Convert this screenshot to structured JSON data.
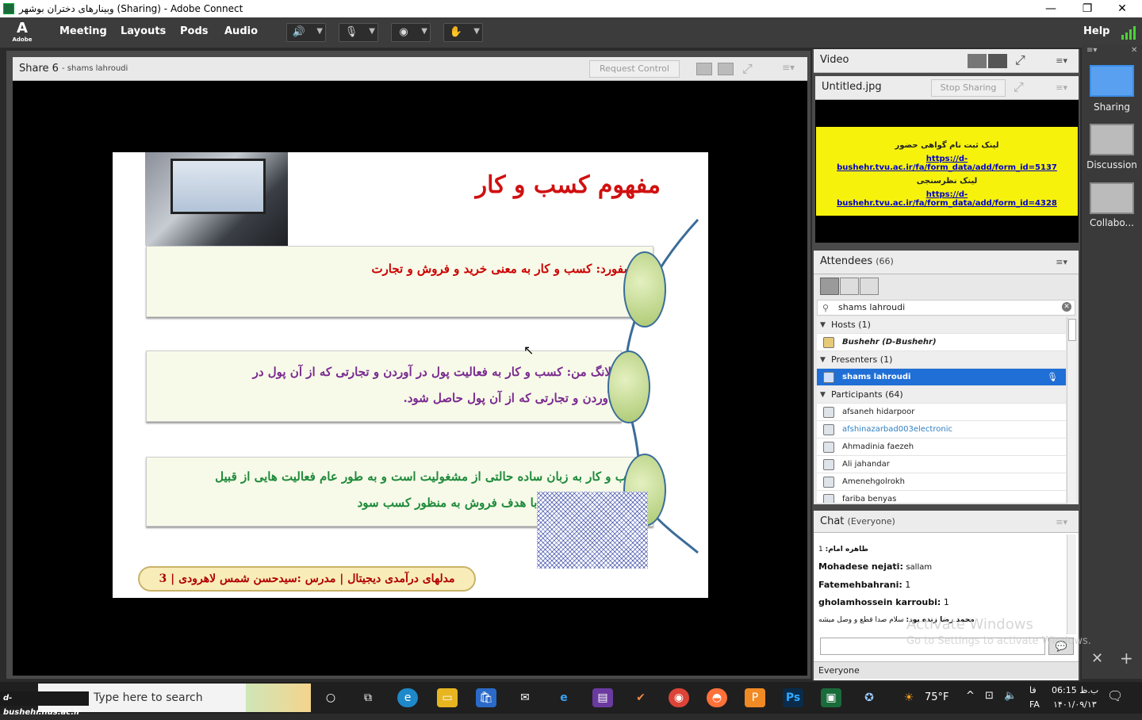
{
  "window": {
    "title": "وبینارهای دختران بوشهر (Sharing) - Adobe Connect",
    "minimize": "—",
    "maximize": "❐",
    "close": "✕"
  },
  "menubar": {
    "logo": "A",
    "logo_sub": "Adobe",
    "items": [
      "Meeting",
      "Layouts",
      "Pods",
      "Audio"
    ],
    "help": "Help"
  },
  "share_pod": {
    "title": "Share 6",
    "presenter": "- shams lahroudi",
    "request_control": "Request Control"
  },
  "slide": {
    "title": "مفهوم کسب و کار",
    "box1": "آکسفورد: کسب و کار به معنی خرید و فروش و تجارت",
    "box2_line1": "لانگ من: کسب و کار به فعالیت  پول در آوردن و تجارتی که از آن پول در",
    "box2_line2": "آوردن و تجارتی که از آن پول حاصل شود.",
    "box3_line1": "کسب و کار به زبان ساده حالتی از مشغولیت است و به طور عام فعالیت هایی از قبیل",
    "box3_line2": "تولید کالاها و خدمات با هدف فروش به منظور کسب سود",
    "footer": "مدلهای درآمدی دیجیتال | مدرس :سیدحسن شمس لاهرودی | 3"
  },
  "video_pod": {
    "title": "Video"
  },
  "image_pod": {
    "title": "Untitled.jpg",
    "stop_sharing": "Stop Sharing",
    "line1": "لینک ثبت نام گواهی حضور",
    "link1": "https://d-bushehr.tvu.ac.ir/fa/form_data/add/form_id=5137",
    "line2": "لینک نظرسنجی",
    "link2": "https://d-bushehr.tvu.ac.ir/fa/form_data/add/form_id=4328"
  },
  "attendees": {
    "title": "Attendees",
    "count": "(66)",
    "search_value": "shams lahroudi",
    "hosts_label": "Hosts (1)",
    "host": "Bushehr (D-Bushehr)",
    "presenters_label": "Presenters (1)",
    "presenter": "shams lahroudi",
    "participants_label": "Participants (64)",
    "participants": [
      "afsaneh hidarpoor",
      "afshinazarbad003electronic",
      "Ahmadinia faezeh",
      "Ali jahandar",
      "Amenehgolrokh",
      "fariba benyas"
    ]
  },
  "chat": {
    "title": "Chat",
    "scope": "(Everyone)",
    "messages": [
      {
        "name": "طاهره امام:",
        "text": "1"
      },
      {
        "name": "Mohadese nejati:",
        "text": "sallam"
      },
      {
        "name": "Fatemehbahrani:",
        "text": "1"
      },
      {
        "name": "gholamhossein karroubi:",
        "text": "1"
      },
      {
        "name": "محمد رضا زنده بود:",
        "text": "سلام صدا قطع و وصل میشه"
      }
    ],
    "recipient": "Everyone"
  },
  "layouts": {
    "items": [
      "Sharing",
      "Discussion",
      "Collabo..."
    ]
  },
  "taskbar": {
    "search_placeholder": "Type here to search",
    "weather": "75°F",
    "lang_top": "فا",
    "lang_bottom": "FA",
    "time": "06:15 ب.ظ",
    "date": "۱۴۰۱/۰۹/۱۳"
  },
  "watermarks": {
    "activate_title": "Activate Windows",
    "activate_sub": "Go to Settings to activate Windows.",
    "site": "d-bushehr.nus.ac.ir"
  }
}
